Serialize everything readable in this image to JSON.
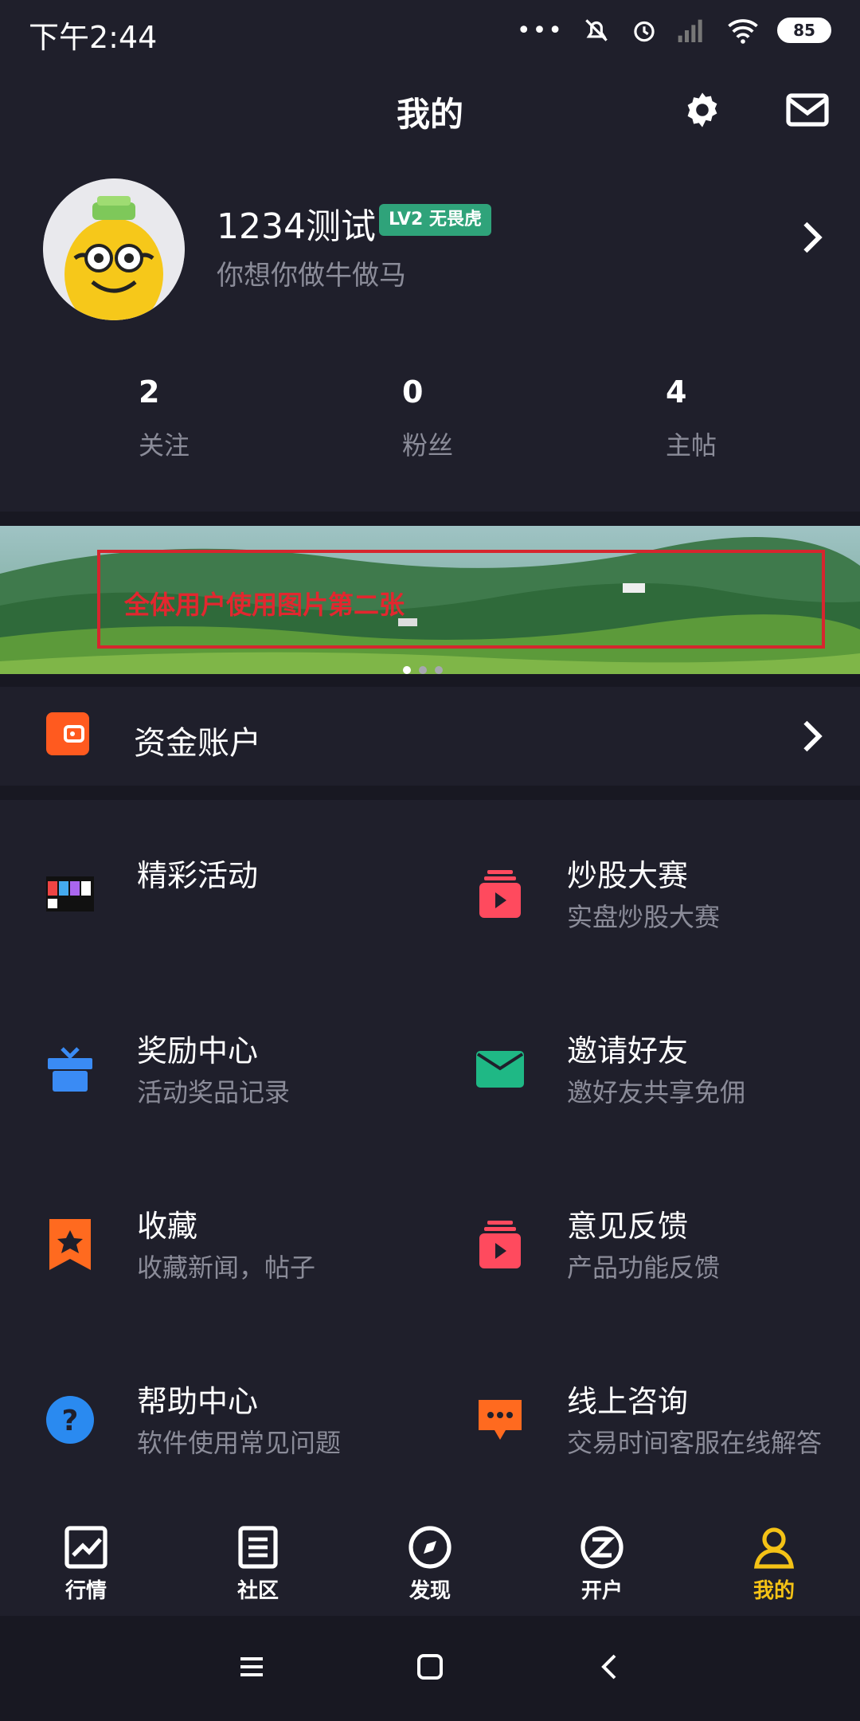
{
  "status_bar": {
    "time": "下午2:44",
    "battery": "85"
  },
  "header": {
    "title": "我的",
    "settings_icon": "gear-icon",
    "message_icon": "mail-icon"
  },
  "profile": {
    "name": "1234测试",
    "level": "LV2 无畏虎",
    "bio": "你想你做牛做马",
    "stats": [
      {
        "value": "2",
        "label": "关注"
      },
      {
        "value": "0",
        "label": "粉丝"
      },
      {
        "value": "4",
        "label": "主帖"
      }
    ]
  },
  "banner": {
    "text": "全体用户使用图片第二张",
    "pages": 3,
    "active_page": 1
  },
  "account": {
    "label": "资金账户"
  },
  "grid": [
    {
      "title": "精彩活动",
      "subtitle": "",
      "icon": "activity-thumbnail-icon"
    },
    {
      "title": "炒股大赛",
      "subtitle": "实盘炒股大赛",
      "icon": "play-bag-icon"
    },
    {
      "title": "奖励中心",
      "subtitle": "活动奖品记录",
      "icon": "gift-icon"
    },
    {
      "title": "邀请好友",
      "subtitle": "邀好友共享免佣",
      "icon": "envelope-icon"
    },
    {
      "title": "收藏",
      "subtitle": "收藏新闻，帖子",
      "icon": "star-bookmark-icon"
    },
    {
      "title": "意见反馈",
      "subtitle": "产品功能反馈",
      "icon": "play-bag-icon"
    },
    {
      "title": "帮助中心",
      "subtitle": "软件使用常见问题",
      "icon": "question-icon"
    },
    {
      "title": "线上咨询",
      "subtitle": "交易时间客服在线解答",
      "icon": "chat-bubble-icon"
    }
  ],
  "bottom_nav": [
    {
      "label": "行情",
      "icon": "chart-icon",
      "active": false
    },
    {
      "label": "社区",
      "icon": "document-icon",
      "active": false
    },
    {
      "label": "发现",
      "icon": "compass-icon",
      "active": false
    },
    {
      "label": "开户",
      "icon": "open-account-icon",
      "active": false
    },
    {
      "label": "我的",
      "icon": "person-icon",
      "active": true
    }
  ],
  "colors": {
    "background": "#1f1f2b",
    "accent": "#f4c216",
    "level_badge": "#2fa37a"
  }
}
